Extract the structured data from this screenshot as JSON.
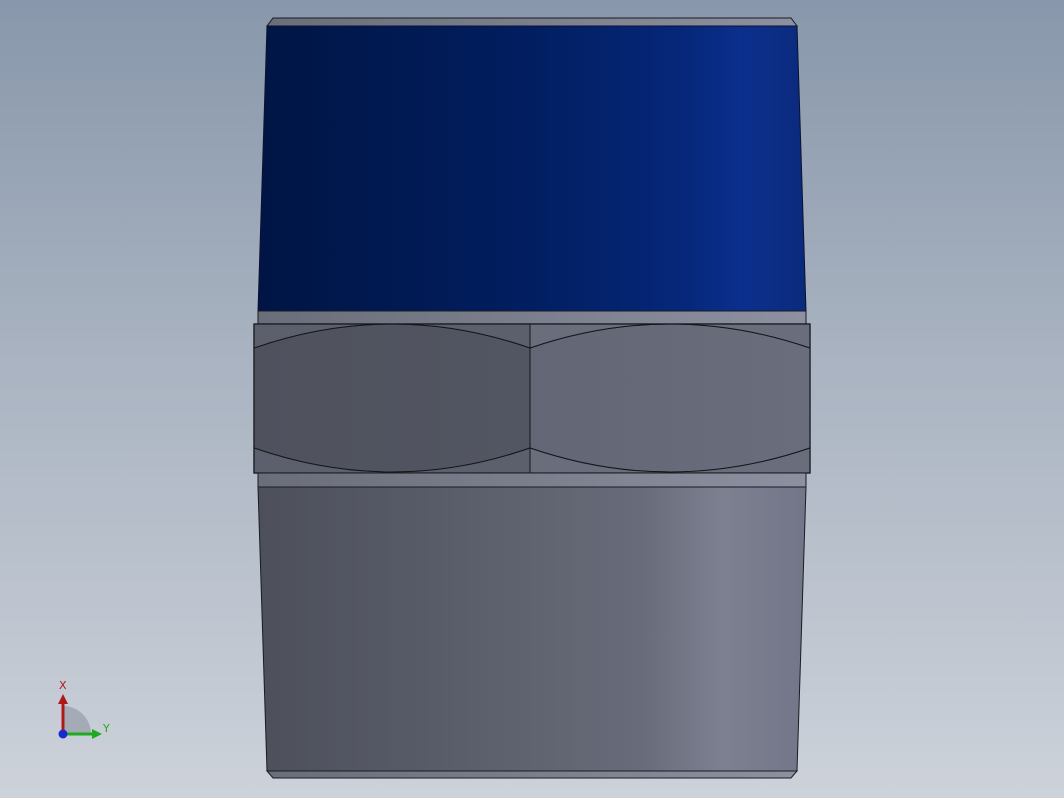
{
  "viewport": {
    "background_top": "#8897ab",
    "background_bottom": "#cdd2da"
  },
  "model": {
    "name": "hex-nipple-fitting",
    "thread_top_color": "#02246e",
    "hex_color": "#5b5f6c",
    "thread_bottom_color": "#5d6170"
  },
  "triad": {
    "x_label": "X",
    "y_label": "Y",
    "x_color": "#b01818",
    "y_color": "#1faa1f",
    "z_color": "#1a2ad0"
  }
}
